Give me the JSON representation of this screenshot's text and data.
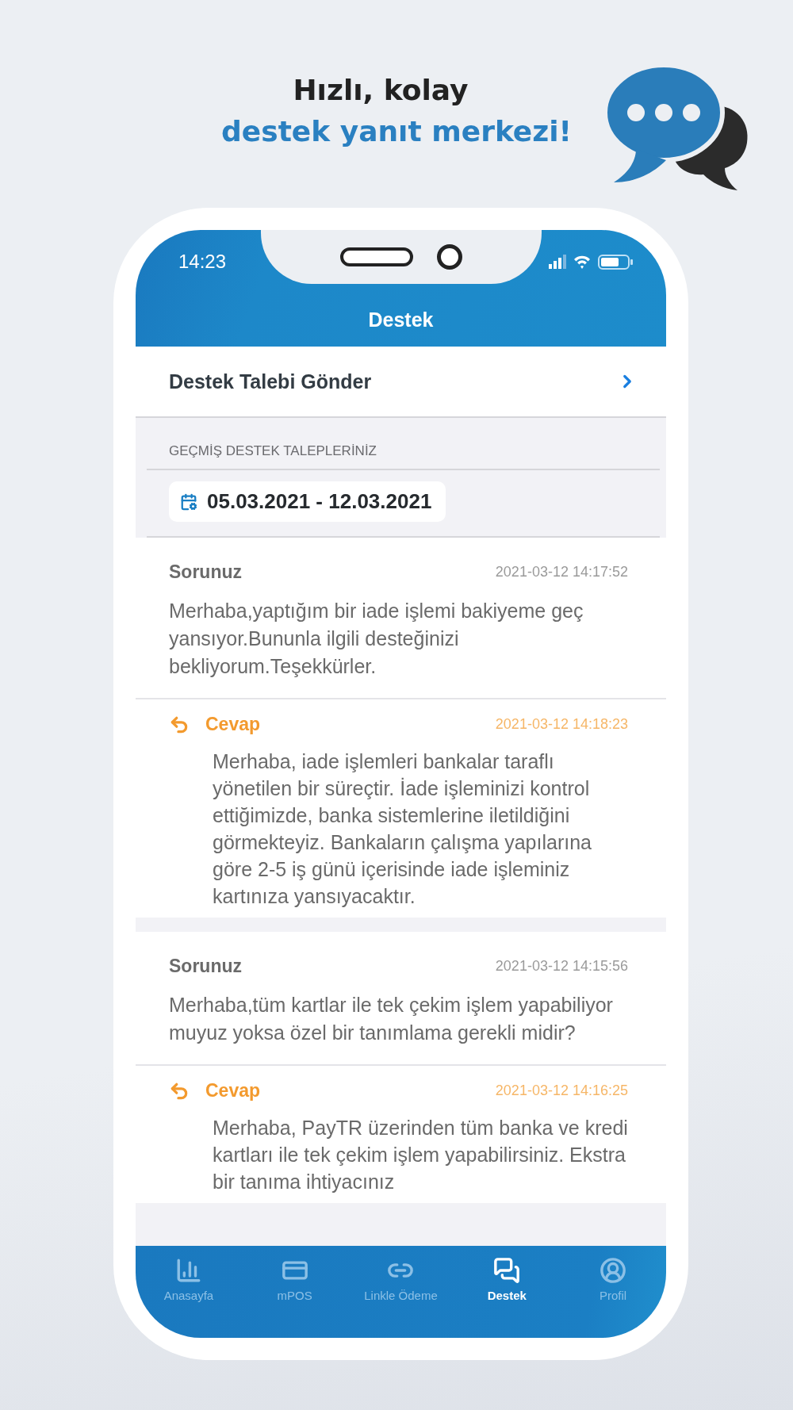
{
  "headline": {
    "line_1": "Hızlı, kolay",
    "line_2": "destek yanıt merkezi!"
  },
  "status_bar": {
    "time": "14:23"
  },
  "header": {
    "title": "Destek"
  },
  "new_request": {
    "label": "Destek Talebi Gönder"
  },
  "history": {
    "section_title": "GEÇMİŞ DESTEK TALEPLERİNİZ",
    "date_range": "05.03.2021 - 12.03.2021"
  },
  "tickets": [
    {
      "question_label": "Sorunuz",
      "question_time": "2021-03-12 14:17:52",
      "question": "Merhaba,yaptığım bir iade işlemi bakiyeme geç yansıyor.Bununla ilgili desteğinizi bekliyorum.Teşekkürler.",
      "answer_label": "Cevap",
      "answer_time": "2021-03-12 14:18:23",
      "answer": "Merhaba, iade işlemleri bankalar taraflı yönetilen bir süreçtir. İade işleminizi kontrol ettiğimizde, banka sistemlerine iletildiğini görmekteyiz. Bankaların çalışma yapılarına göre 2-5 iş günü içerisinde iade işleminiz kartınıza yansıyacaktır."
    },
    {
      "question_label": "Sorunuz",
      "question_time": "2021-03-12 14:15:56",
      "question": "Merhaba,tüm kartlar ile tek çekim işlem yapabiliyor muyuz yoksa özel bir tanımlama gerekli midir?",
      "answer_label": "Cevap",
      "answer_time": "2021-03-12 14:16:25",
      "answer": "Merhaba, PayTR üzerinden tüm banka ve kredi kartları ile tek çekim işlem yapabilirsiniz. Ekstra bir tanıma ihtiyacınız"
    }
  ],
  "tab_bar": [
    {
      "label": "Anasayfa",
      "selected": false
    },
    {
      "label": "mPOS",
      "selected": false
    },
    {
      "label": "Linkle Ödeme",
      "selected": false
    },
    {
      "label": "Destek",
      "selected": true
    },
    {
      "label": "Profil",
      "selected": false
    }
  ]
}
